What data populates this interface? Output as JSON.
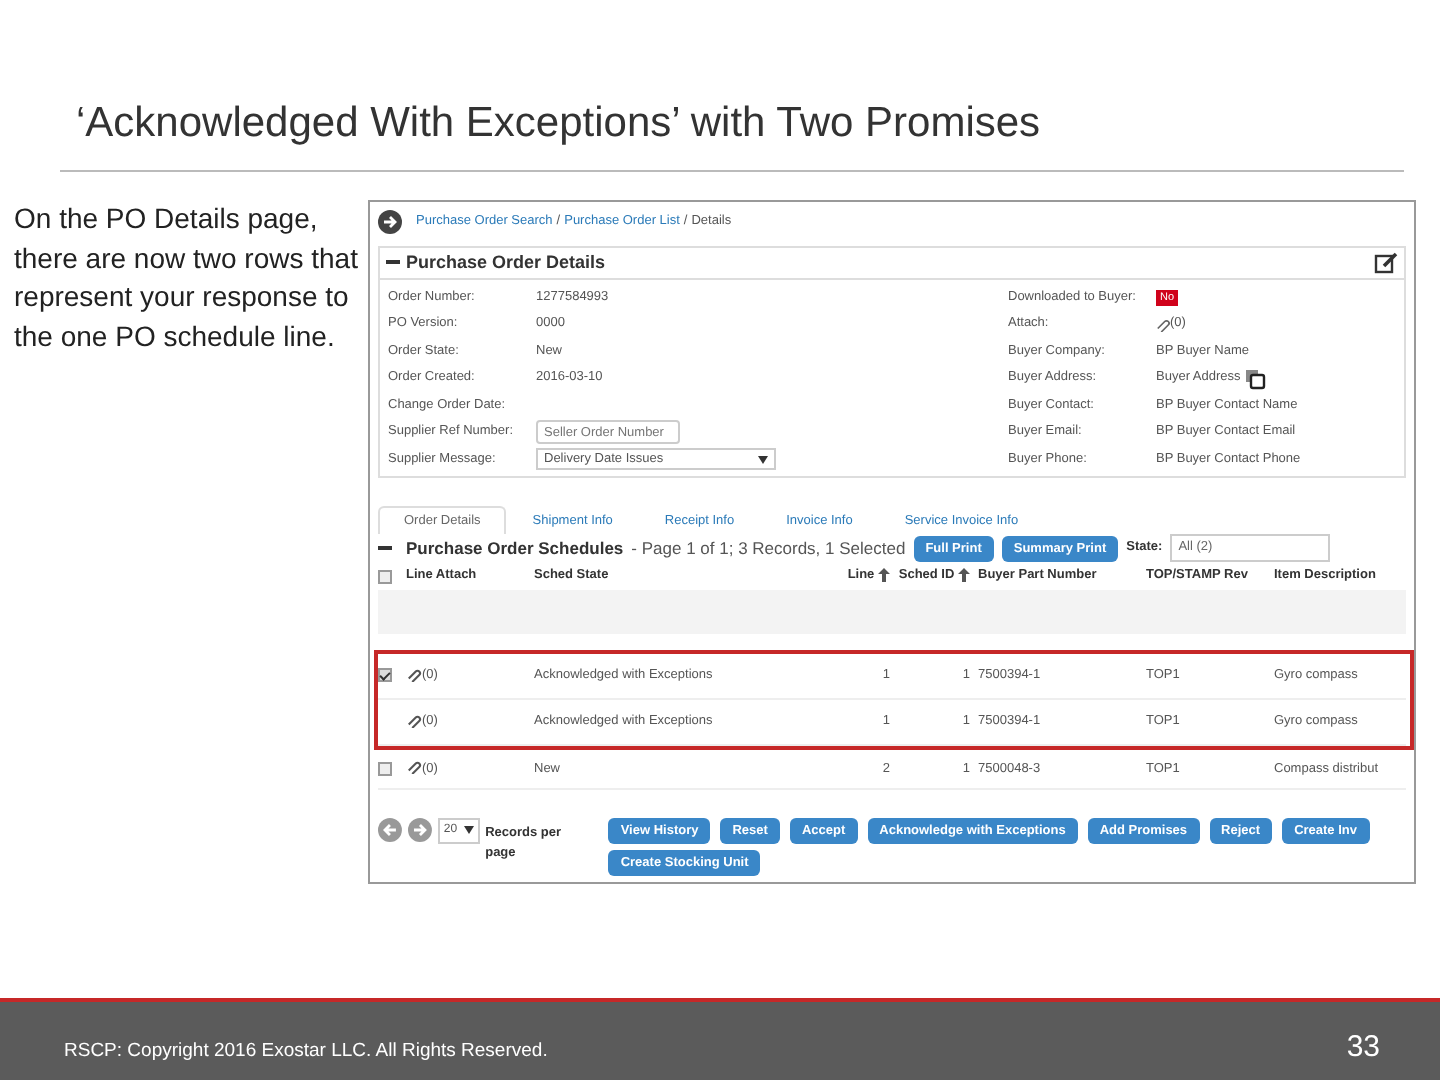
{
  "slide": {
    "title": "‘Acknowledged With Exceptions’ with Two Promises",
    "body": "On the PO Details page, there are now two rows that represent your response to the one PO schedule line."
  },
  "screenshot": {
    "breadcrumb": [
      {
        "label": "Purchase Order Search",
        "kind": "link"
      },
      {
        "label": "/",
        "kind": "sep"
      },
      {
        "label": "Purchase Order List",
        "kind": "link"
      },
      {
        "label": "/",
        "kind": "sep"
      },
      {
        "label": "Details",
        "kind": "current"
      }
    ],
    "details": {
      "title": "Purchase Order Details",
      "left_fields": [
        {
          "label": "Order Number:",
          "value": "1277584993",
          "kind": "text"
        },
        {
          "label": "PO Version:",
          "value": "0000",
          "kind": "text"
        },
        {
          "label": "Order State:",
          "value": "New",
          "kind": "text"
        },
        {
          "label": "Order Created:",
          "value": "2016-03-10",
          "kind": "text"
        },
        {
          "label": "Change Order Date:",
          "kind": "text"
        },
        {
          "label": "Supplier Ref Number:",
          "placeholder": "Seller Order Number",
          "kind": "input"
        },
        {
          "label": "Supplier Message:",
          "value": "Delivery Date Issues",
          "kind": "select"
        }
      ],
      "right_fields": [
        {
          "label": "Downloaded to Buyer:",
          "value": "No",
          "kind": "badge"
        },
        {
          "label": "Attach:",
          "value": "(0)",
          "kind": "attach"
        },
        {
          "label": "Buyer Company:",
          "value": "BP Buyer Name",
          "kind": "text"
        },
        {
          "label": "Buyer Address:",
          "value": "Buyer Address",
          "kind": "copy"
        },
        {
          "label": "Buyer Contact:",
          "value": "BP Buyer Contact Name",
          "kind": "text"
        },
        {
          "label": "Buyer Email:",
          "value": "BP Buyer Contact Email",
          "kind": "text"
        },
        {
          "label": "Buyer Phone:",
          "value": "BP Buyer Contact Phone",
          "kind": "text"
        }
      ]
    },
    "tabs": [
      {
        "label": "Order Details",
        "selected": true
      },
      {
        "label": "Shipment Info",
        "selected": false
      },
      {
        "label": "Receipt Info",
        "selected": false
      },
      {
        "label": "Invoice Info",
        "selected": false
      },
      {
        "label": "Service Invoice Info",
        "selected": false
      }
    ],
    "schedules": {
      "title": "Purchase Order Schedules",
      "summary": "- Page 1 of 1; 3 Records, 1 Selected",
      "buttons": [
        "Full Print",
        "Summary Print"
      ],
      "header_checked": false,
      "state_label": "State:",
      "state_value": "All (2)",
      "columns": [
        {
          "label": "Line Attach",
          "sort": false
        },
        {
          "label": "Sched State",
          "sort": false
        },
        {
          "label": "Line",
          "sort": true
        },
        {
          "label": "Sched ID",
          "sort": true
        },
        {
          "label": "Buyer Part Number",
          "sort": false
        },
        {
          "label": "TOP/STAMP Rev",
          "sort": false
        },
        {
          "label": "Item Description",
          "sort": false
        }
      ],
      "rows": [
        {
          "kind": "schedule",
          "checked": true,
          "callout": true,
          "attach": "(0)",
          "sched_state": "Acknowledged with Exceptions",
          "line": "1",
          "sched_id": "1",
          "buyer_part": "7500394-1",
          "rev": "TOP1",
          "description": "Gyro compass"
        },
        {
          "kind": "promise",
          "callout": true,
          "attach": "(0)",
          "sched_state": "Acknowledged with Exceptions",
          "line": "1",
          "sched_id": "1",
          "buyer_part": "7500394-1",
          "rev": "TOP1",
          "description": "Gyro compass"
        },
        {
          "kind": "schedule",
          "checked": false,
          "callout": false,
          "attach": "(0)",
          "sched_state": "New",
          "line": "2",
          "sched_id": "1",
          "buyer_part": "7500048-3",
          "rev": "TOP1",
          "description": "Compass distribut"
        }
      ]
    },
    "pager": {
      "per_page": "20",
      "label": "Records per page"
    },
    "actions": [
      "View History",
      "Reset",
      "Accept",
      "Acknowledge with Exceptions",
      "Add Promises",
      "Reject",
      "Create Inv",
      "Create Stocking Unit"
    ]
  },
  "footer": {
    "copyright": "RSCP: Copyright 2016 Exostar LLC. All Rights Reserved.",
    "page": "33"
  }
}
